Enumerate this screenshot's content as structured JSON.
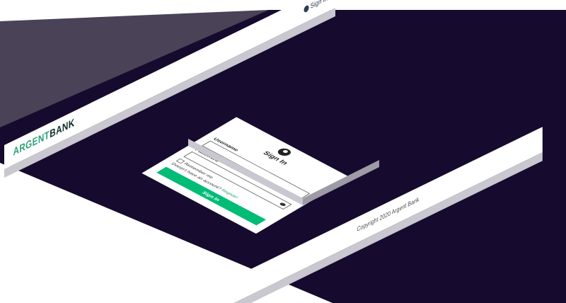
{
  "header": {
    "brand_part1": "ARGENT",
    "brand_part2": "BANK",
    "signin_link": "Sign In"
  },
  "form": {
    "title": "Sign In",
    "username_label": "Username",
    "password_label": "Password",
    "remember_label": "Remember me",
    "no_account_text": "Doesn't have an account?",
    "register_link": "Register",
    "submit_label": "Sign In"
  },
  "footer": {
    "copyright": "Copyright 2020 Argent Bank"
  },
  "colors": {
    "background": "#160a2e",
    "accent": "#00bc77",
    "brand_green": "#2c9e76"
  }
}
